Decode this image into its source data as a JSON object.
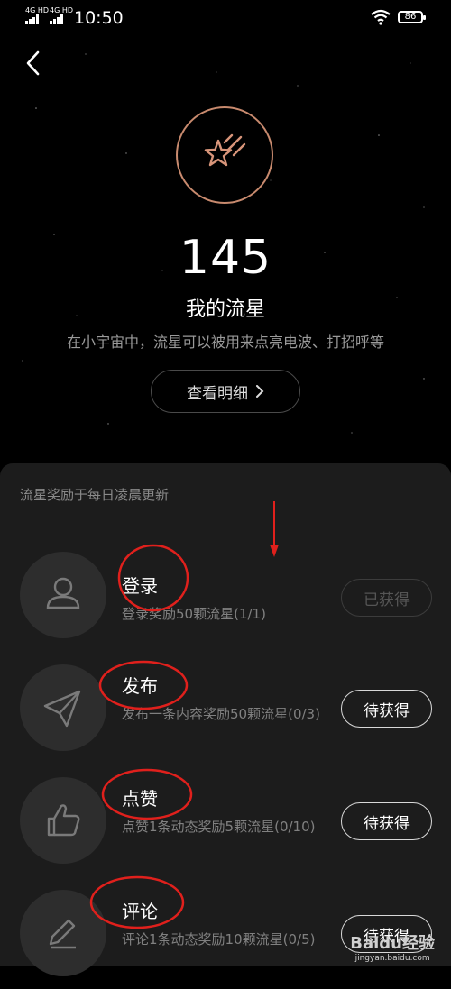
{
  "status_bar": {
    "signal1": "4G HD",
    "signal2": "4G HD",
    "time": "10:50",
    "battery": "86"
  },
  "header": {
    "count": "145",
    "title": "我的流星",
    "subtitle": "在小宇宙中，流星可以被用来点亮电波、打招呼等",
    "detail_label": "查看明细"
  },
  "panel": {
    "note": "流星奖励于每日凌晨更新",
    "tasks": [
      {
        "name": "登录",
        "desc": "登录奖励50颗流星(1/1)",
        "button": "已获得",
        "state": "done",
        "icon": "user-icon"
      },
      {
        "name": "发布",
        "desc": "发布一条内容奖励50颗流星(0/3)",
        "button": "待获得",
        "state": "todo",
        "icon": "send-icon"
      },
      {
        "name": "点赞",
        "desc": "点赞1条动态奖励5颗流星(0/10)",
        "button": "待获得",
        "state": "todo",
        "icon": "thumbs-up-icon"
      },
      {
        "name": "评论",
        "desc": "评论1条动态奖励10颗流星(0/5)",
        "button": "待获得",
        "state": "todo",
        "icon": "pencil-icon"
      }
    ]
  },
  "watermark": {
    "line1": "Baidu经验",
    "line2": "jingyan.baidu.com"
  },
  "colors": {
    "background": "#000000",
    "panel": "#1c1c1c",
    "accent_ring": "#c88a6e",
    "annotation_red": "#e0201c"
  }
}
